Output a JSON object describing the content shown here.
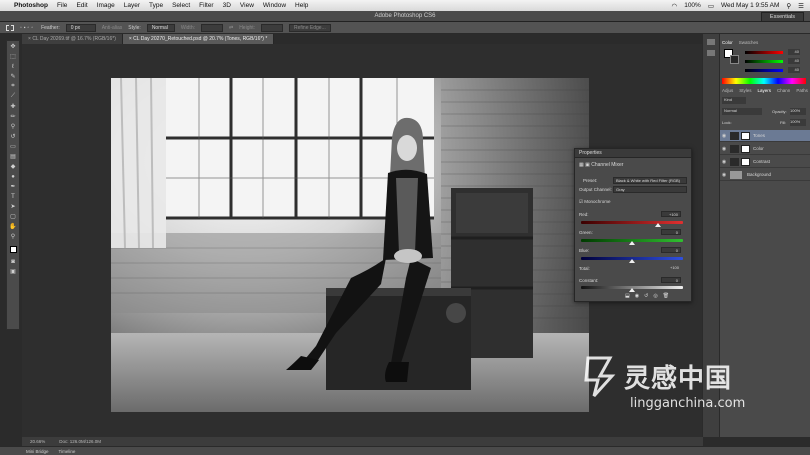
{
  "menubar": {
    "app": "Photoshop",
    "items": [
      "File",
      "Edit",
      "Image",
      "Layer",
      "Type",
      "Select",
      "Filter",
      "3D",
      "View",
      "Window",
      "Help"
    ],
    "battery": "100%",
    "clock": "Wed May 1  9:55 AM"
  },
  "window": {
    "title": "Adobe Photoshop CS6",
    "workspace": "Essentials"
  },
  "options": {
    "feather_label": "Feather:",
    "feather_value": "0 px",
    "antialias": "Anti-alias",
    "style_label": "Style:",
    "style_value": "Normal",
    "width_label": "Width:",
    "height_label": "Height:",
    "refine": "Refine Edge..."
  },
  "tabs": [
    {
      "label": "CL Day 20269.tif @ 16.7% (RGB/16*)"
    },
    {
      "label": "CL Day 20270_Retouched.psd @ 20.7% (Tones, RGB/16*) *"
    }
  ],
  "properties": {
    "header": "Properties",
    "adjustment": "Channel Mixer",
    "preset_label": "Preset:",
    "preset_value": "Black & White with Red Filter (RGB)",
    "output_label": "Output Channel:",
    "output_value": "Gray",
    "monochrome": "Monochrome",
    "red_label": "Red:",
    "red_value": "+100",
    "green_label": "Green:",
    "green_value": "0",
    "blue_label": "Blue:",
    "blue_value": "0",
    "total_label": "Total:",
    "total_value": "+100",
    "constant_label": "Constant:",
    "constant_value": "0",
    "red_level": 0.75,
    "green_level": 0.5,
    "blue_level": 0.5,
    "constant_level": 0.5
  },
  "dock": {
    "color_tabs": [
      "Color",
      "Swatches"
    ],
    "color_values": [
      "40",
      "40",
      "40"
    ],
    "adj_tabs": [
      "Adjus",
      "Styles",
      "Layers",
      "Chann",
      "Paths"
    ],
    "kind": "Kind",
    "blend": "Normal",
    "opacity_label": "Opacity:",
    "opacity_value": "100%",
    "lock_label": "Lock:",
    "fill_label": "Fill:",
    "fill_value": "100%",
    "layers": [
      {
        "name": "Tones",
        "selected": true
      },
      {
        "name": "Color",
        "selected": false
      },
      {
        "name": "Contrast",
        "selected": false
      },
      {
        "name": "Background",
        "selected": false
      }
    ]
  },
  "status": {
    "zoom": "20.66%",
    "doc": "Doc: 126.0M/126.0M"
  },
  "bottom": {
    "tabs": [
      "Mini Bridge",
      "Timeline"
    ]
  },
  "watermark": {
    "cn": "灵感中国",
    "en": "lingganchina.com"
  },
  "colors": {
    "panel": "#4a4a4a",
    "selection": "#6b7a94",
    "app_bg": "#2b2b2b"
  }
}
